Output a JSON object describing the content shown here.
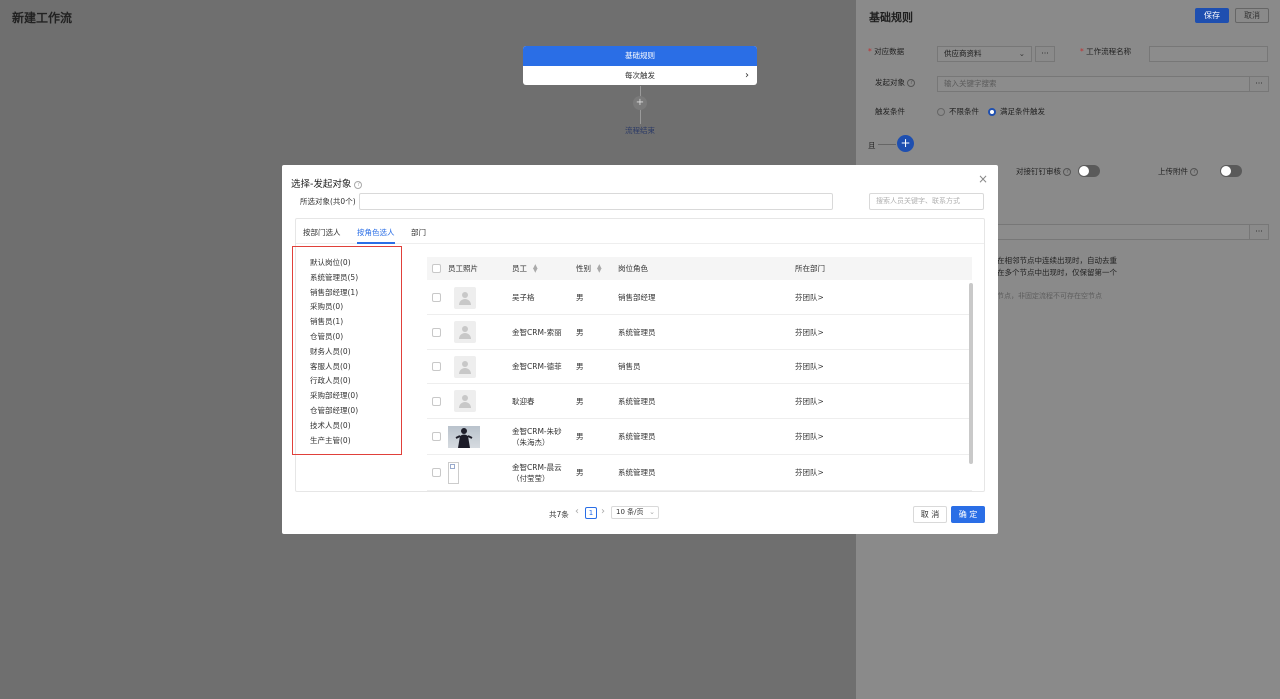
{
  "page": {
    "title": "新建工作流"
  },
  "canvas": {
    "node_title": "基础规则",
    "node_sub": "每次触发",
    "add_symbol": "+",
    "end_label": "流程结束"
  },
  "side_panel": {
    "title": "基础规则",
    "save_label": "保存",
    "cancel_label": "取消",
    "data_label": "对应数据",
    "data_value": "供应商资料",
    "more_symbol": "···",
    "workflow_name_label": "工作流程名称",
    "trigger_obj_label": "发起对象",
    "trigger_obj_placeholder": "输入关键字搜索",
    "trigger_cond_label": "触发条件",
    "cond_option_1": "不限条件",
    "cond_option_2": "满足条件触发",
    "and_label": "且",
    "dingtalk_label": "对接钉钉审核",
    "attachment_label": "上传附件",
    "hint_line1": "在相邻节点中连续出现时，自动去重",
    "hint_line2": "在多个节点中出现时，仅保留第一个",
    "hint_line3": "节点，非固定流程不可存在空节点"
  },
  "modal": {
    "title": "选择-发起对象",
    "close_symbol": "×",
    "selected_label": "所选对象(共0个)",
    "search_placeholder": "搜索人员关键字、联系方式",
    "tabs": [
      "按部门选人",
      "按角色选人",
      "部门"
    ],
    "roles": [
      "默认岗位(0)",
      "系统管理员(5)",
      "销售部经理(1)",
      "采购员(0)",
      "销售员(1)",
      "仓管员(0)",
      "财务人员(0)",
      "客服人员(0)",
      "行政人员(0)",
      "采购部经理(0)",
      "仓管部经理(0)",
      "技术人员(0)",
      "生产主管(0)"
    ],
    "columns": {
      "photo": "员工照片",
      "employee": "员工",
      "gender": "性别",
      "role": "岗位角色",
      "dept": "所在部门"
    },
    "rows": [
      {
        "name": "吴子格",
        "gender": "男",
        "role": "销售部经理",
        "dept": "芬团队>",
        "photo": "placeholder"
      },
      {
        "name": "金智CRM-索丽",
        "gender": "男",
        "role": "系统管理员",
        "dept": "芬团队>",
        "photo": "placeholder"
      },
      {
        "name": "金智CRM-德菲",
        "gender": "男",
        "role": "销售员",
        "dept": "芬团队>",
        "photo": "placeholder"
      },
      {
        "name": "耿迎春",
        "gender": "男",
        "role": "系统管理员",
        "dept": "芬团队>",
        "photo": "placeholder"
      },
      {
        "name": "金智CRM-朱砂",
        "name2": "（朱海杰）",
        "gender": "男",
        "role": "系统管理员",
        "dept": "芬团队>",
        "photo": "person"
      },
      {
        "name": "金智CRM-晨云",
        "name2": "（付莹莹）",
        "gender": "男",
        "role": "系统管理员",
        "dept": "芬团队>",
        "photo": "broken"
      }
    ],
    "pagination": {
      "total": "共7条",
      "prev": "‹",
      "page": "1",
      "next": "›",
      "page_size": "10 条/页"
    },
    "cancel_label": "取 消",
    "ok_label": "确 定"
  },
  "colors": {
    "accent": "#2a6ee6",
    "highlight_box": "#e0403a"
  }
}
